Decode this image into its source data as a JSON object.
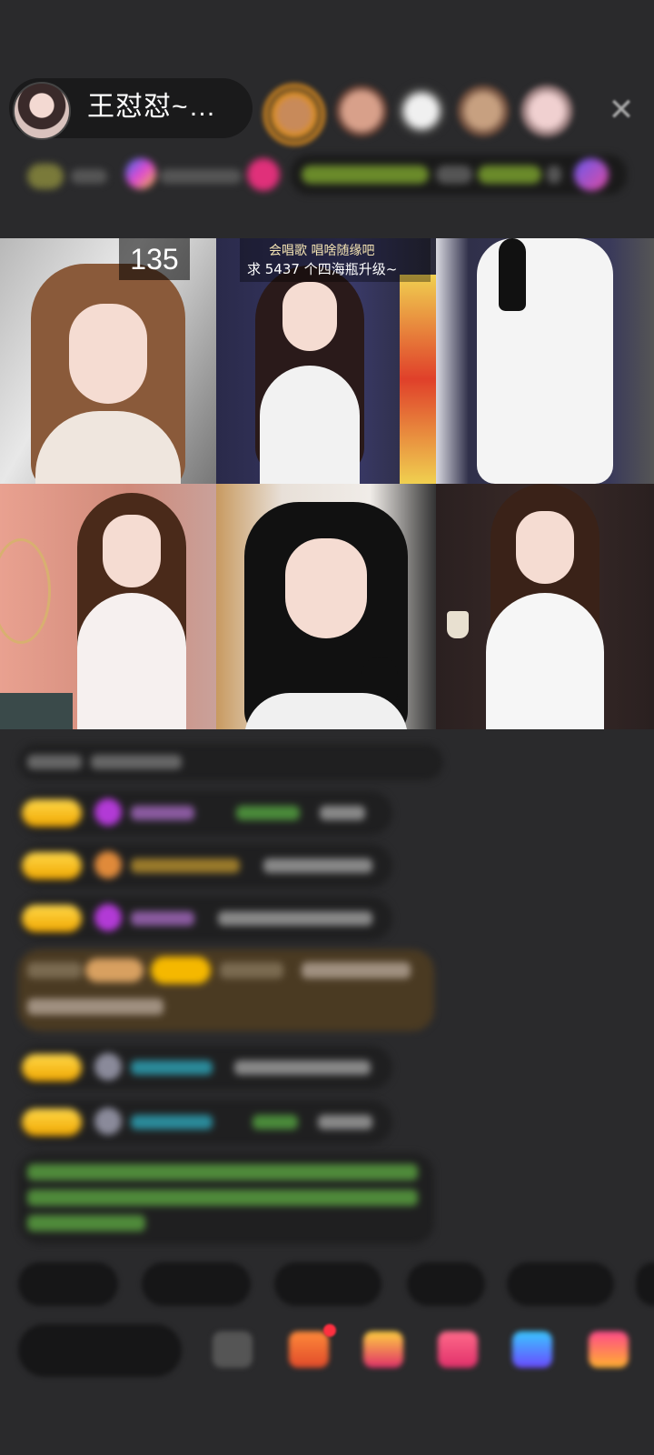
{
  "host": {
    "name": "王怼怼~…"
  },
  "icons": {
    "close": "close-icon",
    "avatar": "avatar"
  },
  "grid": {
    "counter": "135",
    "banner_line1": "会唱歌 唱啥随缘吧",
    "banner_line2": "求 5437 个四海瓶升级~"
  },
  "colors": {
    "background": "#2a2a2c",
    "badge_gold": "#f5c000",
    "chat_green": "#6ec05a",
    "chat_teal": "#37b7c6",
    "purple_heart": "#b23ad6"
  }
}
